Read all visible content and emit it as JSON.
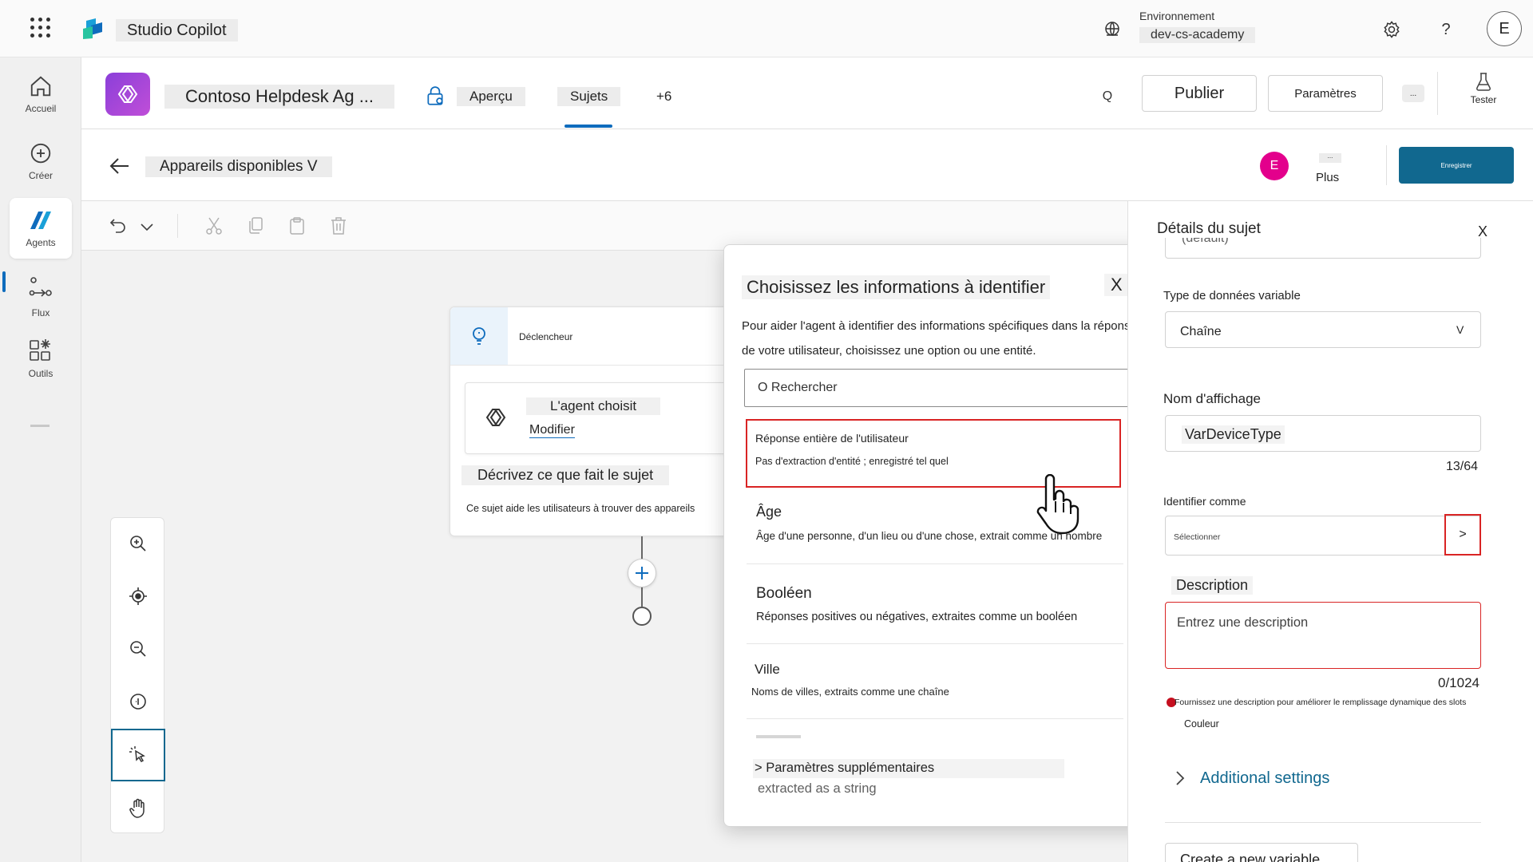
{
  "header": {
    "app_title": "Studio Copilot",
    "environment_label": "Environnement",
    "environment_value": "dev-cs-academy",
    "user_initial": "E",
    "help_label": "?"
  },
  "rail": {
    "items": [
      {
        "label": "Accueil"
      },
      {
        "label": "Créer"
      },
      {
        "label": "Agents"
      },
      {
        "label": "Flux"
      },
      {
        "label": "Outils"
      }
    ]
  },
  "agent": {
    "name": "Contoso Helpdesk Ag ...",
    "tabs": [
      {
        "label": "Aperçu"
      },
      {
        "label": "Sujets"
      },
      {
        "label": "+6"
      }
    ],
    "search_label": "Q",
    "publish_label": "Publier",
    "settings_label": "Paramètres",
    "more_label": "...",
    "test_label": "Tester"
  },
  "topic": {
    "name": "Appareils disponibles V",
    "user_initial": "E",
    "more_dots": "...",
    "more_label": "Plus",
    "save_label": "Enregistrer"
  },
  "node": {
    "trigger_label": "Déclencheur",
    "agent_chooses": "L'agent choisit",
    "edit_label": "Modifier",
    "describe_title": "Décrivez ce que fait le sujet",
    "describe_text": "Ce sujet aide les utilisateurs à trouver des appareils"
  },
  "modal": {
    "title": "Choisissez les informations à identifier",
    "close_label": "X",
    "description": "Pour aider l'agent à identifier des informations spécifiques dans la réponse de votre utilisateur, choisissez une option ou une entité.",
    "search_placeholder": "O Rechercher",
    "options": [
      {
        "title": "Réponse entière de l'utilisateur",
        "desc": "Pas d'extraction d'entité ; enregistré tel quel"
      },
      {
        "title": "Âge",
        "desc": "Âge d'une personne, d'un lieu ou d'une chose, extrait comme un nombre"
      },
      {
        "title": "Booléen",
        "desc": "Réponses positives ou négatives, extraites comme un booléen"
      },
      {
        "title": "Ville",
        "desc": "Noms de villes, extraits comme une chaîne"
      }
    ],
    "extra_settings": "> Paramètres supplémentaires",
    "extra_desc": "extracted as a string"
  },
  "details": {
    "title": "Détails du sujet",
    "close_label": "X",
    "top_field_value": "(default)",
    "var_type_label": "Type de données variable",
    "var_type_value": "Chaîne",
    "var_type_chevron": "V",
    "display_name_label": "Nom d'affichage",
    "display_name_value": "VarDeviceType",
    "display_name_count": "13/64",
    "identify_label": "Identifier comme",
    "identify_placeholder": "Sélectionner",
    "identify_chevron": ">",
    "description_label": "Description",
    "description_placeholder": "Entrez une description",
    "description_count": "0/1024",
    "warning_text": "Fournissez une description pour améliorer le remplissage dynamique des slots",
    "color_label": "Couleur",
    "additional_settings": "Additional settings",
    "create_variable": "Create a new variable"
  }
}
